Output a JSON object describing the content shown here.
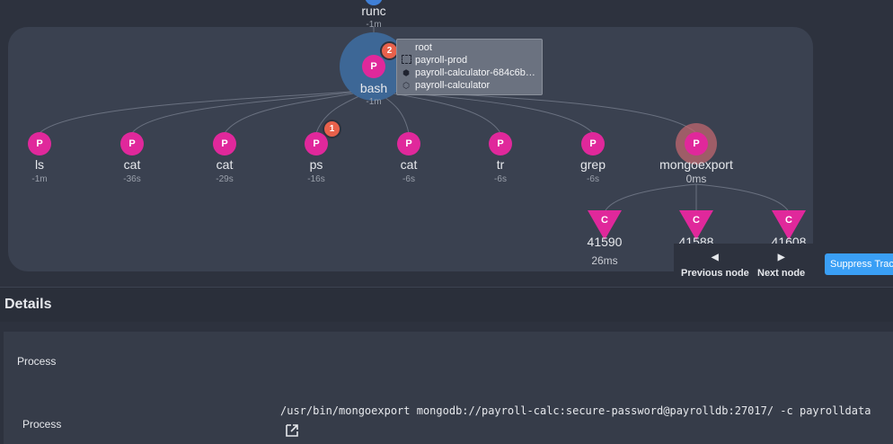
{
  "graph": {
    "top_node": {
      "name": "runc",
      "time": "-1m"
    },
    "bash_node": {
      "letter": "P",
      "name": "bash",
      "time": "-1m",
      "badge": "2"
    },
    "tooltip": {
      "rows": [
        {
          "icon": "user-icon",
          "text": "root"
        },
        {
          "icon": "namespace-icon",
          "text": "payroll-prod"
        },
        {
          "icon": "pod-icon",
          "text": "payroll-calculator-684c6b…"
        },
        {
          "icon": "container-icon",
          "text": "payroll-calculator"
        }
      ]
    },
    "children": [
      {
        "letter": "P",
        "name": "ls",
        "time": "-1m"
      },
      {
        "letter": "P",
        "name": "cat",
        "time": "-36s"
      },
      {
        "letter": "P",
        "name": "cat",
        "time": "-29s"
      },
      {
        "letter": "P",
        "name": "ps",
        "time": "-16s",
        "badge": "1"
      },
      {
        "letter": "P",
        "name": "cat",
        "time": "-6s"
      },
      {
        "letter": "P",
        "name": "tr",
        "time": "-6s"
      },
      {
        "letter": "P",
        "name": "grep",
        "time": "-6s"
      },
      {
        "letter": "P",
        "name": "mongoexport",
        "time": "0ms"
      }
    ],
    "connections": [
      {
        "letter": "C",
        "name": "41590",
        "time": "26ms"
      },
      {
        "letter": "C",
        "name": "41588"
      },
      {
        "letter": "C",
        "name": "41608"
      }
    ],
    "colors": {
      "process": "#e0289b",
      "badge": "#e8614b",
      "group": "#3a4150",
      "selected_halo": "#c0676f"
    }
  },
  "nav": {
    "previous": "Previous node",
    "next": "Next node"
  },
  "suppress_button": "Suppress Trace",
  "details": {
    "title": "Details",
    "section_label": "Process",
    "row_label": "Process",
    "command": "/usr/bin/mongoexport mongodb://payroll-calc:secure-password@payrolldb:27017/ -c payrolldata"
  }
}
